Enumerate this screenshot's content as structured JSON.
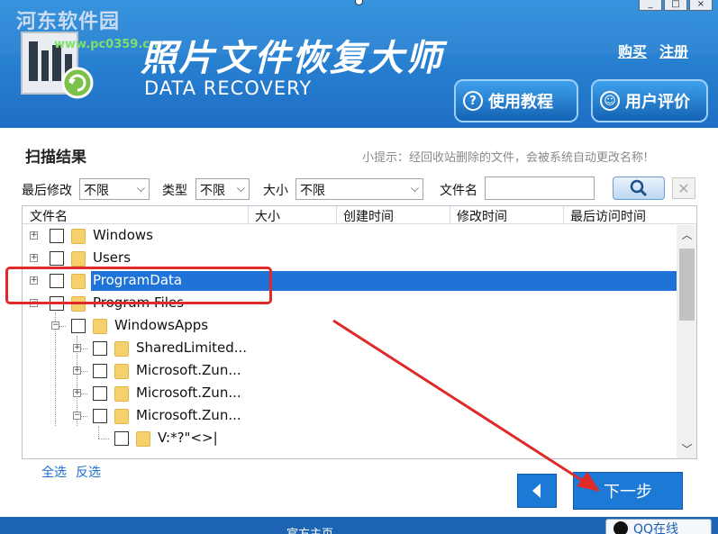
{
  "header": {
    "watermark": "河东软件园",
    "watermark_url": "www.pc0359.cn",
    "app_title": "照片文件恢复大师",
    "app_subtitle": "DATA RECOVERY",
    "links": [
      "购买",
      "注册"
    ],
    "tutorial_button": "使用教程",
    "review_button": "用户评价",
    "window_controls": [
      "_",
      "□",
      "×"
    ]
  },
  "scan": {
    "title": "扫描结果",
    "tip": "小提示：经回收站删除的文件，会被系统自动更改名称!"
  },
  "filters": {
    "last_modified_label": "最后修改",
    "last_modified_value": "不限",
    "type_label": "类型",
    "type_value": "不限",
    "size_label": "大小",
    "size_value": "不限",
    "filename_label": "文件名",
    "filename_value": ""
  },
  "tree": {
    "columns": [
      "文件名",
      "大小",
      "创建时间",
      "修改时间",
      "最后访问时间"
    ],
    "rows": [
      {
        "label": "Windows",
        "level": 0,
        "expander": "+",
        "selected": false
      },
      {
        "label": "Users",
        "level": 0,
        "expander": "+",
        "selected": false
      },
      {
        "label": "ProgramData",
        "level": 0,
        "expander": "+",
        "selected": true
      },
      {
        "label": "Program Files",
        "level": 0,
        "expander": "−",
        "selected": false
      },
      {
        "label": "WindowsApps",
        "level": 1,
        "expander": "−",
        "selected": false
      },
      {
        "label": "SharedLimited...",
        "level": 2,
        "expander": "+",
        "selected": false
      },
      {
        "label": "Microsoft.Zun...",
        "level": 2,
        "expander": "+",
        "selected": false
      },
      {
        "label": "Microsoft.Zun...",
        "level": 2,
        "expander": "+",
        "selected": false
      },
      {
        "label": "Microsoft.Zun...",
        "level": 2,
        "expander": "−",
        "selected": false
      },
      {
        "label": "V:*?\"<>|",
        "level": 3,
        "expander": "",
        "selected": false
      }
    ]
  },
  "actions": {
    "select_all": "全选",
    "invert_select": "反选",
    "back_icon": "left-arrow-icon",
    "next_label": "下一步"
  },
  "footer": {
    "text": "官方主页",
    "qq_label": "QQ在线"
  },
  "colors": {
    "header_blue": "#1f6fc4",
    "selection_blue": "#1e72d8",
    "annotation_red": "#e02a2a",
    "folder_yellow": "#f6d06a"
  }
}
